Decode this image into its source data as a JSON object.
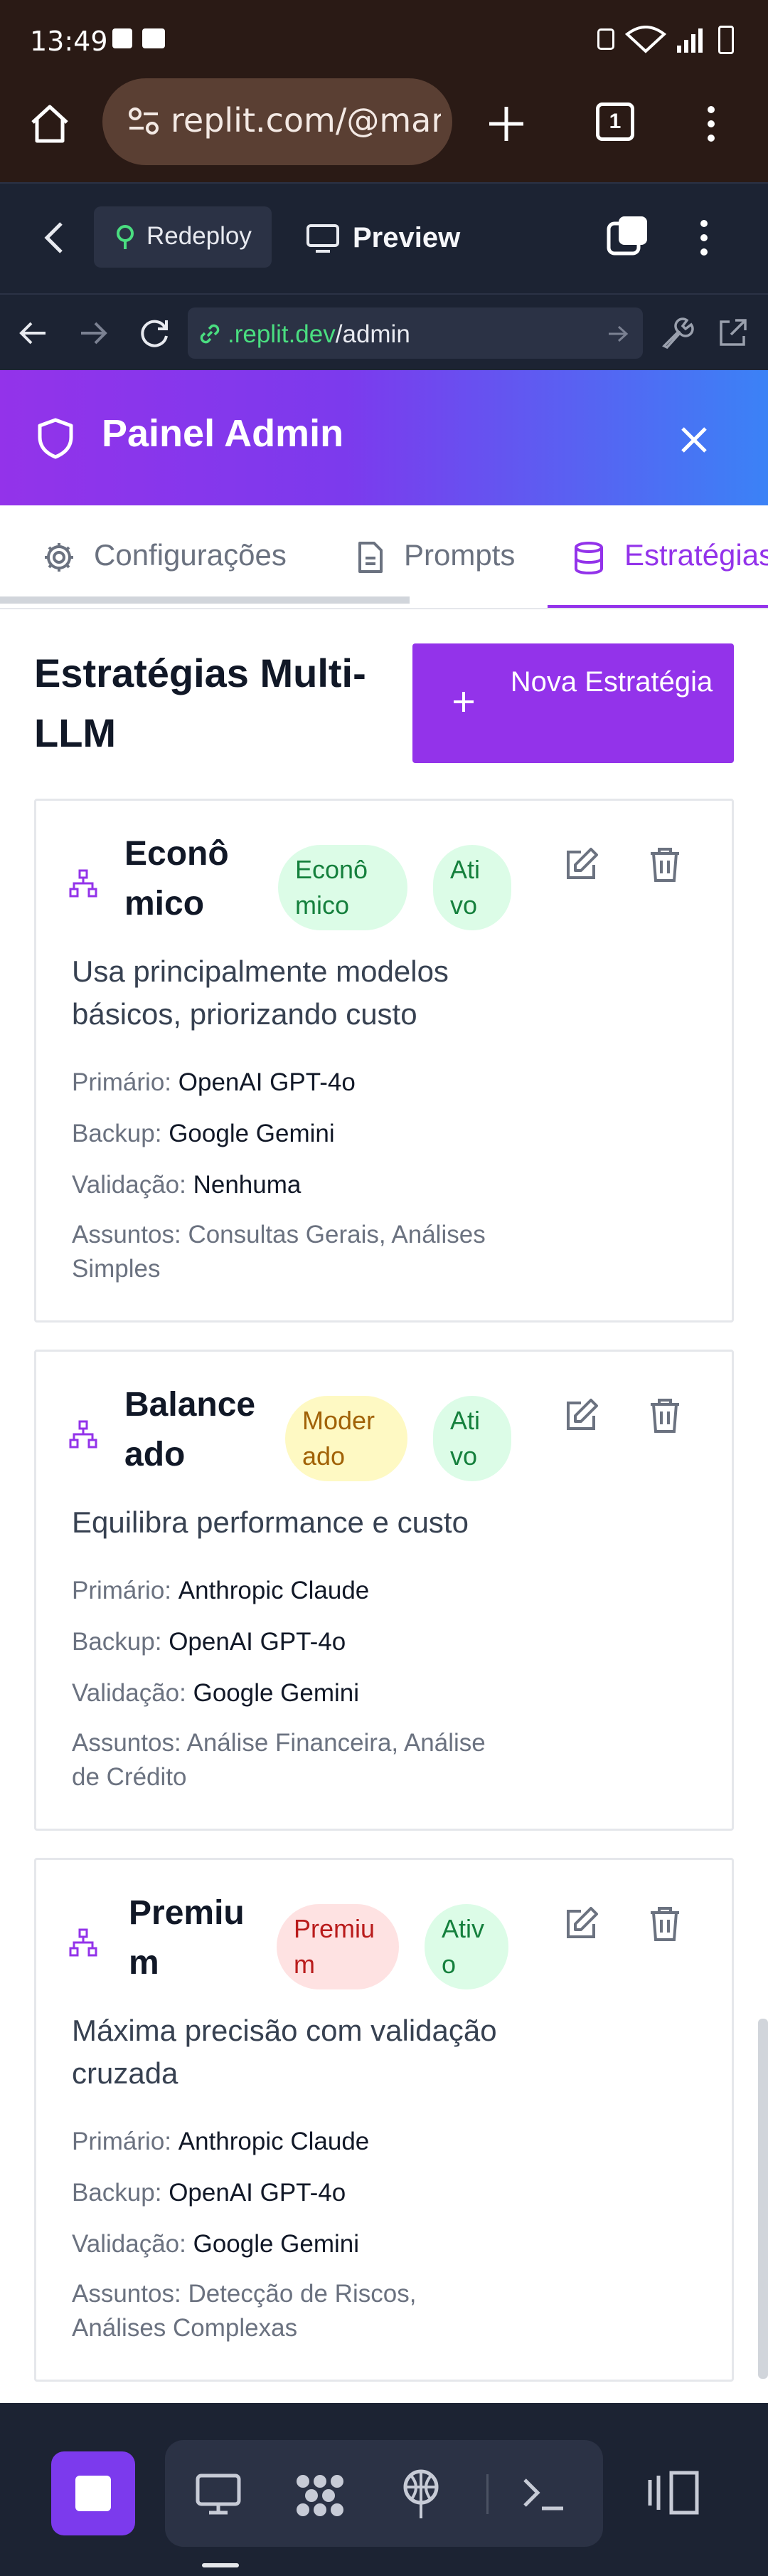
{
  "status_bar": {
    "time": "13:49"
  },
  "browser": {
    "url": "replit.com/@mari",
    "tab_count": "1"
  },
  "replit_bar": {
    "redeploy_label": "Redeploy",
    "preview_label": "Preview"
  },
  "address": {
    "domain": ".replit.dev",
    "path": "/admin"
  },
  "admin_panel": {
    "title": "Painel Admin"
  },
  "tabs": [
    {
      "label": "Configurações",
      "active": false
    },
    {
      "label": "Prompts",
      "active": false
    },
    {
      "label": "Estratégias",
      "active": true
    }
  ],
  "section": {
    "title": "Estratégias Multi-LLM",
    "new_button": "Nova Estratégia"
  },
  "labels": {
    "primary": "Primário:",
    "backup": "Backup:",
    "validation": "Validação:",
    "subjects": "Assuntos:"
  },
  "strategies": [
    {
      "name": "Econô mico",
      "level_badge": "Econô mico",
      "status_badge": "Ati vo",
      "description": "Usa principalmente modelos básicos, priorizando custo",
      "primary": "OpenAI GPT-4o",
      "backup": "Google Gemini",
      "validation": "Nenhuma",
      "subjects": "Consultas Gerais, Análises Simples"
    },
    {
      "name": "Balance ado",
      "level_badge": "Moder ado",
      "status_badge": "Ati vo",
      "description": "Equilibra performance e custo",
      "primary": "Anthropic Claude",
      "backup": "OpenAI GPT-4o",
      "validation": "Google Gemini",
      "subjects": "Análise Financeira, Análise de Crédito"
    },
    {
      "name": "Premiu m",
      "level_badge": "Premiu m",
      "status_badge": "Ativ o",
      "description": "Máxima precisão com validação cruzada",
      "primary": "Anthropic Claude",
      "backup": "OpenAI GPT-4o",
      "validation": "Google Gemini",
      "subjects": "Detecção de Riscos, Análises Complexas"
    }
  ],
  "colors": {
    "accent": "#9333ea",
    "green_badge_bg": "#dcfce7",
    "green_badge_text": "#15803d",
    "yellow_badge_bg": "#fef9c3",
    "yellow_badge_text": "#a16207",
    "red_badge_bg": "#fee2e2",
    "red_badge_text": "#b91c1c"
  }
}
